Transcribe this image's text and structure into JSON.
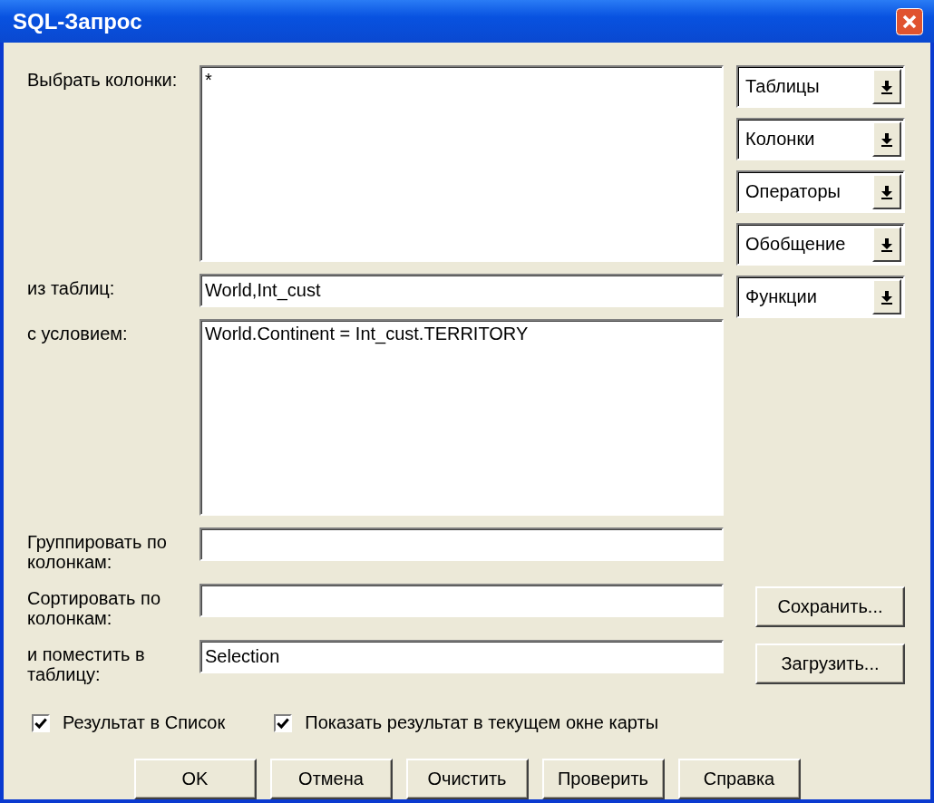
{
  "window": {
    "title": "SQL-Запрос"
  },
  "fields": [
    {
      "label": "Выбрать колонки:",
      "value": "*",
      "kind": "area"
    },
    {
      "label": "из таблиц:",
      "value": "World,Int_cust",
      "kind": "line"
    },
    {
      "label": "с условием:",
      "value": "World.Continent = Int_cust.TERRITORY",
      "kind": "area"
    },
    {
      "label": "Группировать по колонкам:",
      "kind": "line"
    },
    {
      "label": "Сортировать по колонкам:",
      "kind": "line"
    },
    {
      "label": "и поместить в таблицу:",
      "value": "Selection",
      "kind": "line"
    }
  ],
  "dropdowns": [
    "Таблицы",
    "Колонки",
    "Операторы",
    "Обобщение",
    "Функции"
  ],
  "side_buttons": [
    "Сохранить...",
    "Загрузить..."
  ],
  "checkboxes": [
    {
      "label": "Результат в Список",
      "checked": true
    },
    {
      "label": "Показать результат в текущем окне карты",
      "checked": true
    }
  ],
  "buttons": [
    "OK",
    "Отмена",
    "Очистить",
    "Проверить",
    "Справка"
  ]
}
